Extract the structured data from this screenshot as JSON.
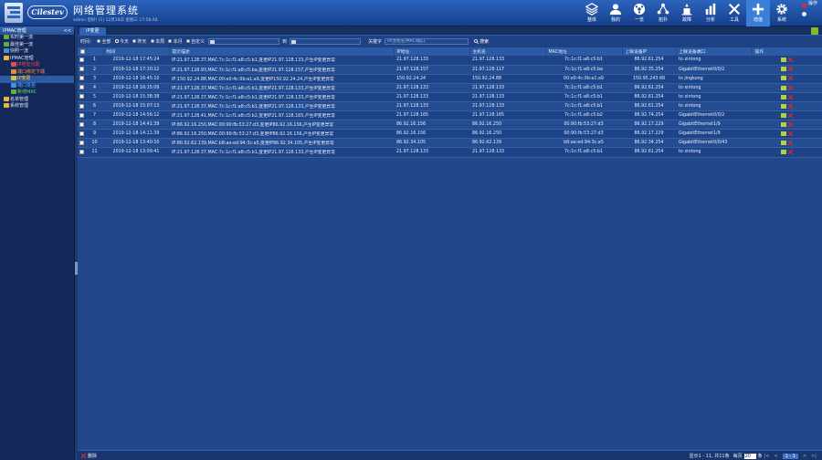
{
  "header": {
    "logo_text": "Cilestev",
    "title": "网络管理系统",
    "subtitle": "admin 您好! (1) 12月18日 星期三 17:58:48"
  },
  "topnav": [
    {
      "label": "整体",
      "icon": "layers-icon"
    },
    {
      "label": "我的",
      "icon": "user-icon"
    },
    {
      "label": "一览",
      "icon": "dashboard-icon"
    },
    {
      "label": "拓扑",
      "icon": "topology-icon"
    },
    {
      "label": "故障",
      "icon": "alarm-icon"
    },
    {
      "label": "分析",
      "icon": "bar-chart-icon"
    },
    {
      "label": "工具",
      "icon": "tools-icon"
    },
    {
      "label": "增值",
      "icon": "plus-icon",
      "active": true
    },
    {
      "label": "系统",
      "icon": "gear-icon"
    }
  ],
  "topright_label": "操作",
  "sidebar": {
    "header": "IPMAC管理",
    "collapse": "<<",
    "items": [
      {
        "label": "实时第一流",
        "level": 1,
        "color": "#dce6f6",
        "icon_color": "#5fb044"
      },
      {
        "label": "最佳第一流",
        "level": 1,
        "color": "#dce6f6",
        "icon_color": "#5fb044"
      },
      {
        "label": "快照一流",
        "level": 1,
        "color": "#dce6f6",
        "icon_color": "#4a8fd8"
      },
      {
        "label": "IPMAC管理",
        "level": 1,
        "color": "#dce6f6",
        "icon_color": "#e6b93c"
      },
      {
        "label": "IP地址分配",
        "level": 2,
        "color": "#ff4444",
        "icon_color": "#e05050"
      },
      {
        "label": "端口绑定下端",
        "level": 2,
        "color": "#ff8a3a",
        "icon_color": "#e08a3a"
      },
      {
        "label": "IP变更",
        "level": 2,
        "color": "#ffd400",
        "icon_color": "#d8c13a",
        "active": true
      },
      {
        "label": "端口变更",
        "level": 2,
        "color": "#4fb6ff",
        "icon_color": "#4a8fd8"
      },
      {
        "label": "新增MAC",
        "level": 2,
        "color": "#65d86a",
        "icon_color": "#5fb044"
      },
      {
        "label": "名单管理",
        "level": 1,
        "color": "#dce6f6",
        "icon_color": "#e6b93c"
      },
      {
        "label": "系统管理",
        "level": 1,
        "color": "#dce6f6",
        "icon_color": "#e6b93c"
      }
    ]
  },
  "tab": {
    "label": "IP变更"
  },
  "filter": {
    "time_label": "时间：",
    "ranges": [
      "全部",
      "今天",
      "昨天",
      "本周",
      "本月",
      "自定义"
    ],
    "selected": "今天",
    "to_label": "到",
    "keyword_label": "关键字",
    "keyword_placeholder": "IP/主机名/MAC/端口",
    "search_label": "搜索"
  },
  "table": {
    "columns": [
      "",
      "",
      "时间",
      "提示描述",
      "IP地址",
      "主机名",
      "MAC地址",
      "上联设备IP",
      "上联设备端口",
      "操作"
    ],
    "rows": [
      {
        "n": "1",
        "time": "2019-12-18 17:45:24",
        "desc": "IP:21.97.128.37,MAC:7c:1c:f1:a8:c5:b1,变更IP21.97.128.133,产生IP变更异常",
        "ip": "21.97.128.133",
        "host": "21.97.128.133",
        "mac": "7c:1c:f1:a8:c5:b1",
        "uip": "86.92.61.254",
        "uport": "to xintong"
      },
      {
        "n": "2",
        "time": "2019-12-18 17:10:12",
        "desc": "IP:21.97.128.93,MAC:7c:1c:f1:a8:c5:ba,变更IP21.97.128.157,产生IP变更异常",
        "ip": "21.97.128.157",
        "host": "21.97.128.117",
        "mac": "7c:1c:f1:a8:c5:ba",
        "uip": "86.92.35.254",
        "uport": "GigabitEthernet0/0/2"
      },
      {
        "n": "3",
        "time": "2019-12-18 16:45:10",
        "desc": "IP:150.92.24.88,MAC:00:e0:4c:0b:a1:a9,变更IP150.92.24.24,产生IP变更异常",
        "ip": "150.92.24.24",
        "host": "150.92.24.88",
        "mac": "00:e0:4c:0b:a1:a9",
        "uip": "150.95.243.68",
        "uport": "to jingkong"
      },
      {
        "n": "4",
        "time": "2019-12-18 16:15:09",
        "desc": "IP:21.97.128.37,MAC:7c:1c:f1:a8:c5:b1,变更IP21.97.128.133,产生IP变更异常",
        "ip": "21.97.128.133",
        "host": "21.97.128.133",
        "mac": "7c:1c:f1:a8:c5:b1",
        "uip": "86.92.61.254",
        "uport": "to xintong"
      },
      {
        "n": "5",
        "time": "2019-12-18 15:38:38",
        "desc": "IP:21.97.128.37,MAC:7c:1c:f1:a8:c5:b1,变更IP21.97.128.133,产生IP变更异常",
        "ip": "21.97.128.133",
        "host": "21.97.128.133",
        "mac": "7c:1c:f1:a8:c5:b1",
        "uip": "86.92.61.254",
        "uport": "to xintong"
      },
      {
        "n": "6",
        "time": "2019-12-18 15:07:13",
        "desc": "IP:21.97.128.37,MAC:7c:1c:f1:a8:c5:b1,变更IP21.97.128.133,产生IP变更异常",
        "ip": "21.97.128.133",
        "host": "21.97.128.133",
        "mac": "7c:1c:f1:a8:c5:b1",
        "uip": "86.92.61.254",
        "uport": "to xintong"
      },
      {
        "n": "7",
        "time": "2019-12-18 14:56:12",
        "desc": "IP:21.97.128.41,MAC:7c:1c:f1:a8:c5:b2,变更IP21.97.128.165,产生IP变更异常",
        "ip": "21.97.128.165",
        "host": "21.97.128.165",
        "mac": "7c:1c:f1:a8:c5:b2",
        "uip": "86.92.74.254",
        "uport": "GigabitEthernet0/0/2"
      },
      {
        "n": "8",
        "time": "2019-12-18 14:41:39",
        "desc": "IP:86.92.16.250,MAC:00:90:fb:53:27:d3,变更IP86.92.16.156,产生IP变更异常",
        "ip": "86.92.16.156",
        "host": "86.92.16.250",
        "mac": "00:90:fb:53:27:d3",
        "uip": "86.92.17.229",
        "uport": "GigabitEthernet1/9"
      },
      {
        "n": "9",
        "time": "2019-12-18 14:11:39",
        "desc": "IP:86.92.16.250,MAC:00:90:fb:53:27:d3,变更IP86.92.16.156,产生IP变更异常",
        "ip": "86.92.16.156",
        "host": "86.92.16.250",
        "mac": "00:90:fb:53:27:d3",
        "uip": "86.92.17.229",
        "uport": "GigabitEthernet1/9"
      },
      {
        "n": "10",
        "time": "2019-12-18 13:40:10",
        "desc": "IP:86.92.62.139,MAC:b8:ae:ed:94:3c:a5,变更IP86.92.34.105,产生IP变更异常",
        "ip": "86.92.34.105",
        "host": "86.92.62.139",
        "mac": "b8:ae:ed:94:3c:a5",
        "uip": "86.92.34.254",
        "uport": "GigabitEthernet0/0/43"
      },
      {
        "n": "11",
        "time": "2019-12-18 13:09:41",
        "desc": "IP:21.97.128.37,MAC:7c:1c:f1:a8:c5:b1,变更IP21.97.128.133,产生IP变更异常",
        "ip": "21.97.128.133",
        "host": "21.97.128.133",
        "mac": "7c:1c:f1:a8:c5:b1",
        "uip": "86.92.61.254",
        "uport": "to xintong"
      }
    ]
  },
  "footer": {
    "delete_label": "删除",
    "summary": "显示1 - 11, 共11条",
    "per_page_label": "每页",
    "per_page": "20",
    "per_page_unit": "条",
    "page_info": "1 - 1"
  }
}
